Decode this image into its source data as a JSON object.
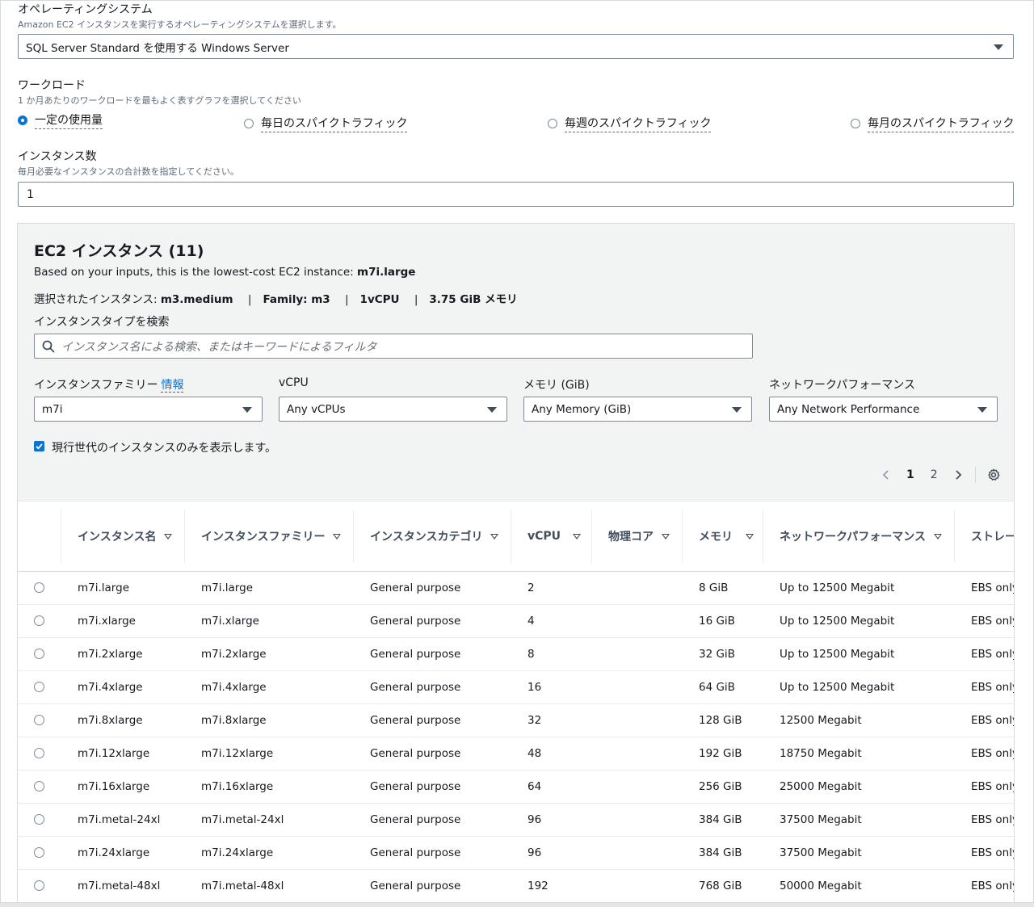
{
  "os": {
    "label": "オペレーティングシステム",
    "description": "Amazon EC2 インスタンスを実行するオペレーティングシステムを選択します。",
    "value": "SQL Server Standard を使用する Windows Server"
  },
  "workload": {
    "label": "ワークロード",
    "description": "1 か月あたりのワークロードを最もよく表すグラフを選択してください",
    "options": [
      "一定の使用量",
      "毎日のスパイクトラフィック",
      "毎週のスパイクトラフィック",
      "毎月のスパイクトラフィック"
    ],
    "selected_index": 0
  },
  "instance_count": {
    "label": "インスタンス数",
    "description": "毎月必要なインスタンスの合計数を指定してください。",
    "value": "1"
  },
  "ec2": {
    "title": "EC2 インスタンス (11)",
    "lowest_cost_prefix": "Based on your inputs, this is the lowest-cost EC2 instance: ",
    "lowest_cost_value": "m7i.large",
    "selected_prefix": "選択されたインスタンス: ",
    "selected_instance": "m3.medium",
    "selected_family": "Family: m3",
    "selected_vcpu": "1vCPU",
    "selected_memory": "3.75 GiB メモリ",
    "separator": "|",
    "search_label": "インスタンスタイプを検索",
    "search_placeholder": "インスタンス名による検索、またはキーワードによるフィルタ",
    "filters": {
      "family_label": "インスタンスファミリー",
      "family_info": "情報",
      "family_value": "m7i",
      "vcpu_label": "vCPU",
      "vcpu_value": "Any vCPUs",
      "memory_label": "メモリ (GiB)",
      "memory_value": "Any Memory (GiB)",
      "network_label": "ネットワークパフォーマンス",
      "network_value": "Any Network Performance"
    },
    "current_gen_label": "現行世代のインスタンスのみを表示します。",
    "current_gen_checked": true,
    "pagination": {
      "pages": [
        "1",
        "2"
      ],
      "current": "1"
    }
  },
  "table": {
    "columns": [
      "インスタンス名",
      "インスタンスファミリー",
      "インスタンスカテゴリ",
      "vCPU",
      "物理コア",
      "メモリ",
      "ネットワークパフォーマンス",
      "ストレー"
    ],
    "rows": [
      [
        "m7i.large",
        "m7i.large",
        "General purpose",
        "2",
        "",
        "8 GiB",
        "Up to 12500 Megabit",
        "EBS only"
      ],
      [
        "m7i.xlarge",
        "m7i.xlarge",
        "General purpose",
        "4",
        "",
        "16 GiB",
        "Up to 12500 Megabit",
        "EBS only"
      ],
      [
        "m7i.2xlarge",
        "m7i.2xlarge",
        "General purpose",
        "8",
        "",
        "32 GiB",
        "Up to 12500 Megabit",
        "EBS only"
      ],
      [
        "m7i.4xlarge",
        "m7i.4xlarge",
        "General purpose",
        "16",
        "",
        "64 GiB",
        "Up to 12500 Megabit",
        "EBS only"
      ],
      [
        "m7i.8xlarge",
        "m7i.8xlarge",
        "General purpose",
        "32",
        "",
        "128 GiB",
        "12500 Megabit",
        "EBS only"
      ],
      [
        "m7i.12xlarge",
        "m7i.12xlarge",
        "General purpose",
        "48",
        "",
        "192 GiB",
        "18750 Megabit",
        "EBS only"
      ],
      [
        "m7i.16xlarge",
        "m7i.16xlarge",
        "General purpose",
        "64",
        "",
        "256 GiB",
        "25000 Megabit",
        "EBS only"
      ],
      [
        "m7i.metal-24xl",
        "m7i.metal-24xl",
        "General purpose",
        "96",
        "",
        "384 GiB",
        "37500 Megabit",
        "EBS only"
      ],
      [
        "m7i.24xlarge",
        "m7i.24xlarge",
        "General purpose",
        "96",
        "",
        "384 GiB",
        "37500 Megabit",
        "EBS only"
      ],
      [
        "m7i.metal-48xl",
        "m7i.metal-48xl",
        "General purpose",
        "192",
        "",
        "768 GiB",
        "50000 Megabit",
        "EBS only"
      ]
    ]
  },
  "colors": {
    "accent": "#0972d3",
    "panel_bg": "#f2f3f3",
    "border": "#7d8998"
  }
}
